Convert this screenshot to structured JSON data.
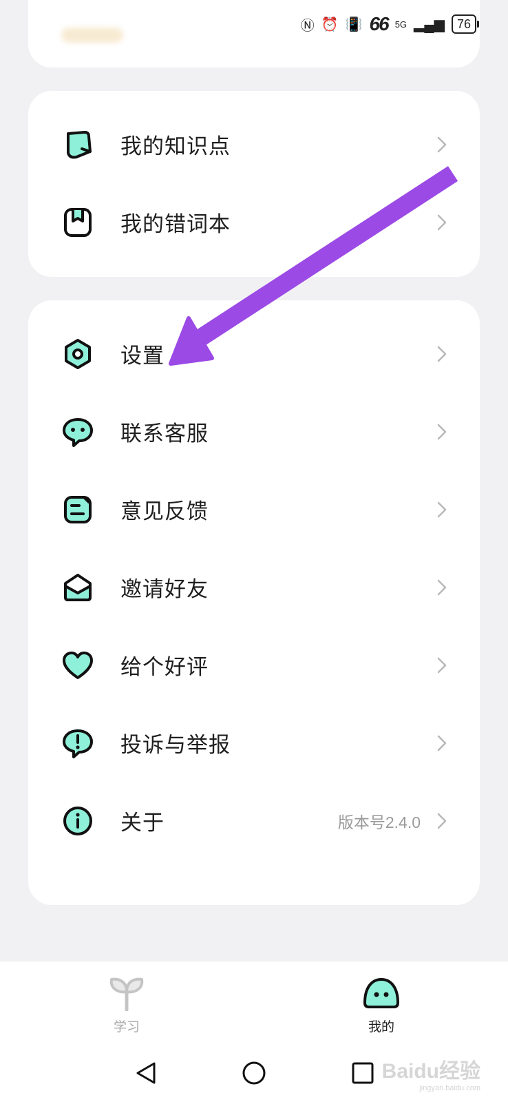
{
  "status": {
    "signal": "66",
    "network": "5G",
    "battery": "76"
  },
  "group1": [
    {
      "label": "我的知识点",
      "icon": "knowledge-icon"
    },
    {
      "label": "我的错词本",
      "icon": "wrong-words-book-icon"
    }
  ],
  "group2": [
    {
      "label": "设置",
      "icon": "settings-icon"
    },
    {
      "label": "联系客服",
      "icon": "customer-service-icon"
    },
    {
      "label": "意见反馈",
      "icon": "feedback-icon"
    },
    {
      "label": "邀请好友",
      "icon": "invite-friends-icon"
    },
    {
      "label": "给个好评",
      "icon": "heart-icon"
    },
    {
      "label": "投诉与举报",
      "icon": "report-icon"
    },
    {
      "label": "关于",
      "icon": "info-icon",
      "extra": "版本号2.4.0"
    }
  ],
  "nav": {
    "study_label": "学习",
    "mine_label": "我的"
  },
  "watermark": {
    "brand": "Baidu经验",
    "url": "jingyan.baidu.com"
  },
  "colors": {
    "accent_mint": "#8ff0d9",
    "arrow_purple": "#9b4ae6",
    "icon_stroke": "#111111"
  }
}
